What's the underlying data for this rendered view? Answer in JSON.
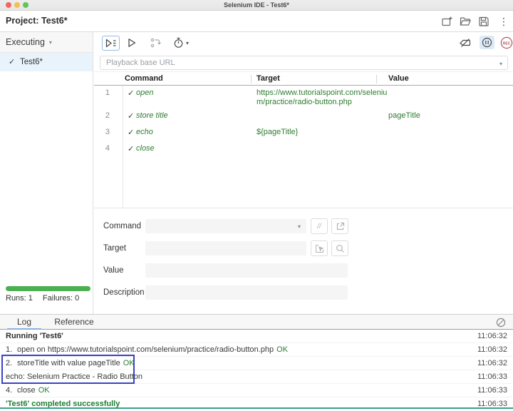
{
  "titlebar": {
    "title": "Selenium IDE - Test6*"
  },
  "project": {
    "label": "Project:",
    "name": "Test6*"
  },
  "sidebar": {
    "dropdown_label": "Executing",
    "test_name": "Test6*",
    "runs": "Runs: 1",
    "failures": "Failures: 0"
  },
  "playback": {
    "placeholder": "Playback base URL"
  },
  "table": {
    "headers": [
      "Command",
      "Target",
      "Value"
    ],
    "rows": [
      {
        "num": "1",
        "command": "open",
        "target": "https://www.tutorialspoint.com/selenium/practice/radio-button.php",
        "value": ""
      },
      {
        "num": "2",
        "command": "store title",
        "target": "",
        "value": "pageTitle"
      },
      {
        "num": "3",
        "command": "echo",
        "target": "${pageTitle}",
        "value": ""
      },
      {
        "num": "4",
        "command": "close",
        "target": "",
        "value": ""
      }
    ]
  },
  "form": {
    "command_label": "Command",
    "target_label": "Target",
    "value_label": "Value",
    "description_label": "Description",
    "comment_button": "//"
  },
  "log_panel": {
    "tabs": [
      "Log",
      "Reference"
    ],
    "entries": [
      {
        "num": "",
        "text": "Running 'Test6'",
        "ok": "",
        "time": "11:06:32"
      },
      {
        "num": "1.",
        "text": "open on https://www.tutorialspoint.com/selenium/practice/radio-button.php",
        "ok": "OK",
        "time": "11:06:32"
      },
      {
        "num": "2.",
        "text": "storeTitle with value pageTitle",
        "ok": "OK",
        "time": "11:06:32"
      },
      {
        "num": "",
        "text": "echo: Selenium Practice - Radio Button",
        "ok": "",
        "time": "11:06:33"
      },
      {
        "num": "4.",
        "text": "close",
        "ok": "OK",
        "time": "11:06:33"
      },
      {
        "num": "",
        "text": "'Test6' completed successfully",
        "ok": "",
        "time": "11:06:33"
      }
    ]
  },
  "colors": {
    "success_green": "#2e7d32",
    "progress_green": "#4caf50",
    "selection_blue": "#3a43c4",
    "record_red": "#b4575a",
    "active_tab_blue": "#8cb0dd",
    "bottom_accent_teal": "#35a387",
    "traffic_red": "#ed6a5e",
    "traffic_yellow": "#f5bf4f",
    "traffic_green": "#61c554"
  }
}
